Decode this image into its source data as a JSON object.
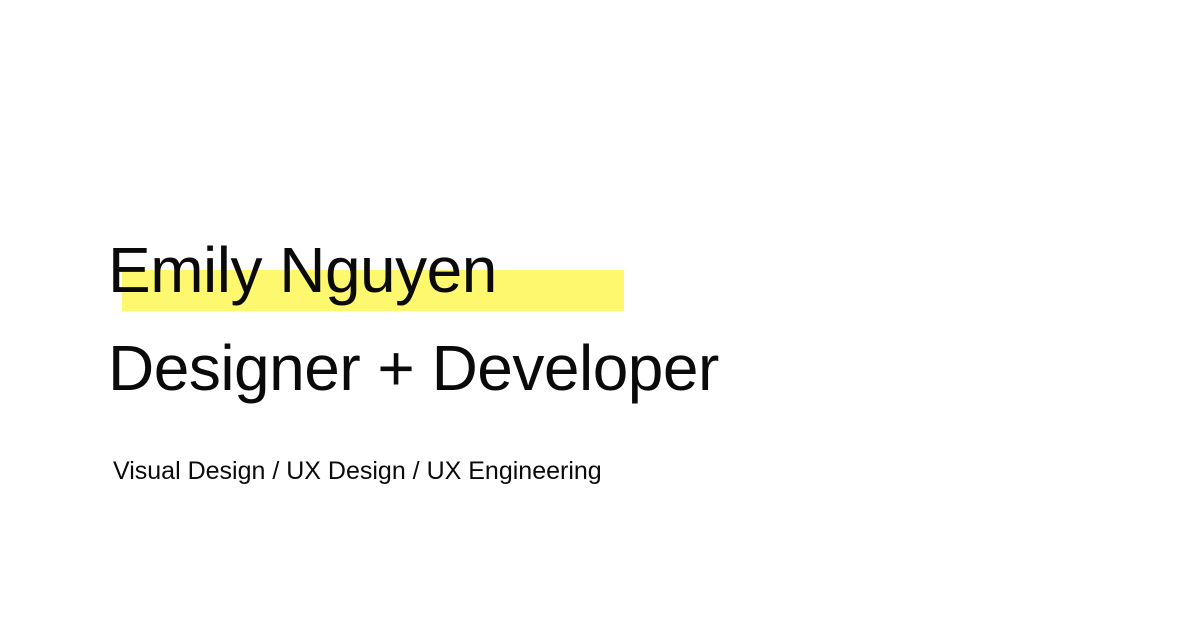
{
  "hero": {
    "name": "Emily Nguyen",
    "role": "Designer + Developer",
    "skills": "Visual Design / UX Design / UX Engineering"
  },
  "colors": {
    "background": "#ffffff",
    "text": "#0a0a0a",
    "highlight": "#fdf86d"
  }
}
